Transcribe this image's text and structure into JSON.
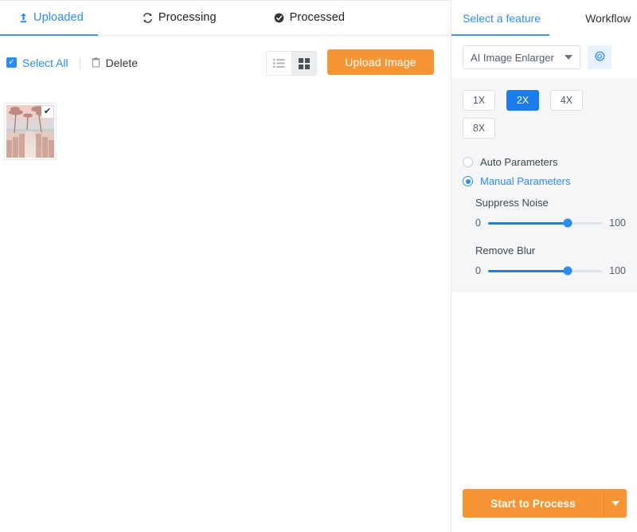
{
  "tabs": [
    {
      "label": "Uploaded",
      "icon": "upload-icon",
      "active": true
    },
    {
      "label": "Processing",
      "icon": "sync-icon",
      "active": false
    },
    {
      "label": "Processed",
      "icon": "check-circle-icon",
      "active": false
    }
  ],
  "toolbar": {
    "select_all_label": "Select All",
    "delete_label": "Delete",
    "upload_label": "Upload Image",
    "view_list": "list-view",
    "view_grid": "grid-view",
    "active_view": "grid"
  },
  "gallery": {
    "items": [
      {
        "name": "beach-boardwalk-thumbnail",
        "selected": true,
        "badge": "✔"
      }
    ]
  },
  "panel": {
    "tabs": [
      {
        "label": "Select a feature",
        "active": true
      },
      {
        "label": "Workflow",
        "active": false
      }
    ],
    "feature": {
      "selected": "AI Image Enlarger",
      "options": [
        "AI Image Enlarger"
      ],
      "settings_icon": "gear-icon"
    },
    "scales": [
      {
        "label": "1X",
        "active": false
      },
      {
        "label": "2X",
        "active": true
      },
      {
        "label": "4X",
        "active": false
      },
      {
        "label": "8X",
        "active": false
      }
    ],
    "modes": [
      {
        "label": "Auto Parameters",
        "selected": false
      },
      {
        "label": "Manual Parameters",
        "selected": true
      }
    ],
    "sliders": [
      {
        "title": "Suppress Noise",
        "min": "0",
        "max": "100",
        "value": 70
      },
      {
        "title": "Remove Blur",
        "min": "0",
        "max": "100",
        "value": 70
      }
    ],
    "footer": {
      "start_label": "Start to Process",
      "dropdown_icon": "chevron-down-icon"
    }
  },
  "colors": {
    "accent_blue": "#2d8cf0",
    "scale_active": "#1b7ceb",
    "orange": "#f79434",
    "panel_grey": "#f5f6f8"
  }
}
